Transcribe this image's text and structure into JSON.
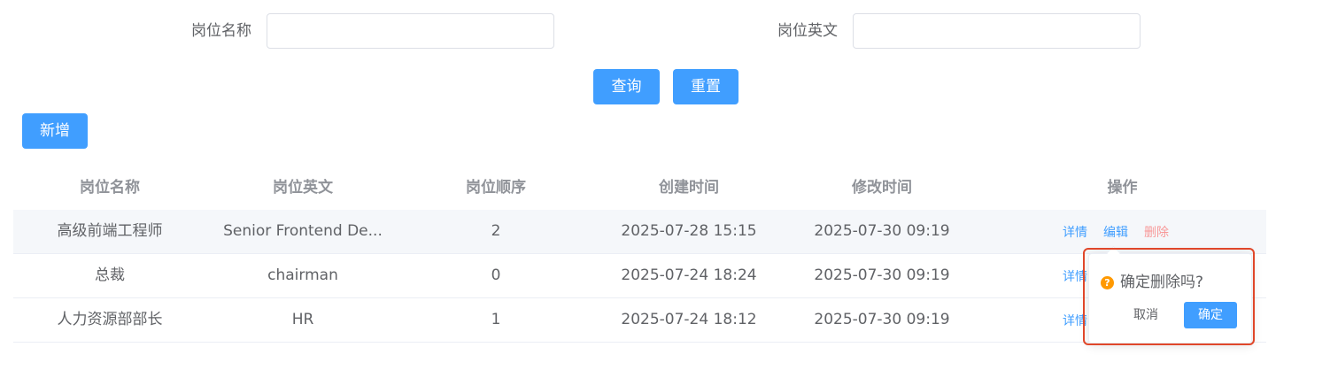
{
  "search": {
    "name_label": "岗位名称",
    "name_value": "",
    "en_label": "岗位英文",
    "en_value": "",
    "query_button": "查询",
    "reset_button": "重置"
  },
  "toolbar": {
    "add_button": "新增"
  },
  "table": {
    "headers": [
      "岗位名称",
      "岗位英文",
      "岗位顺序",
      "创建时间",
      "修改时间",
      "操作"
    ],
    "rows": [
      {
        "name": "高级前端工程师",
        "english": "Senior Frontend De...",
        "order": "2",
        "created": "2025-07-28 15:15",
        "modified": "2025-07-30 09:19"
      },
      {
        "name": "总裁",
        "english": "chairman",
        "order": "0",
        "created": "2025-07-24 18:24",
        "modified": "2025-07-30 09:19"
      },
      {
        "name": "人力资源部部长",
        "english": "HR",
        "order": "1",
        "created": "2025-07-24 18:12",
        "modified": "2025-07-30 09:19"
      }
    ],
    "actions": {
      "detail": "详情",
      "edit": "编辑",
      "delete": "删除"
    }
  },
  "popconfirm": {
    "icon": "question-icon",
    "message": "确定删除吗?",
    "cancel": "取消",
    "confirm": "确定"
  },
  "colors": {
    "primary": "#409eff",
    "danger_text": "#f89898",
    "warning": "#ff9900",
    "highlight_border": "#e0472a"
  }
}
